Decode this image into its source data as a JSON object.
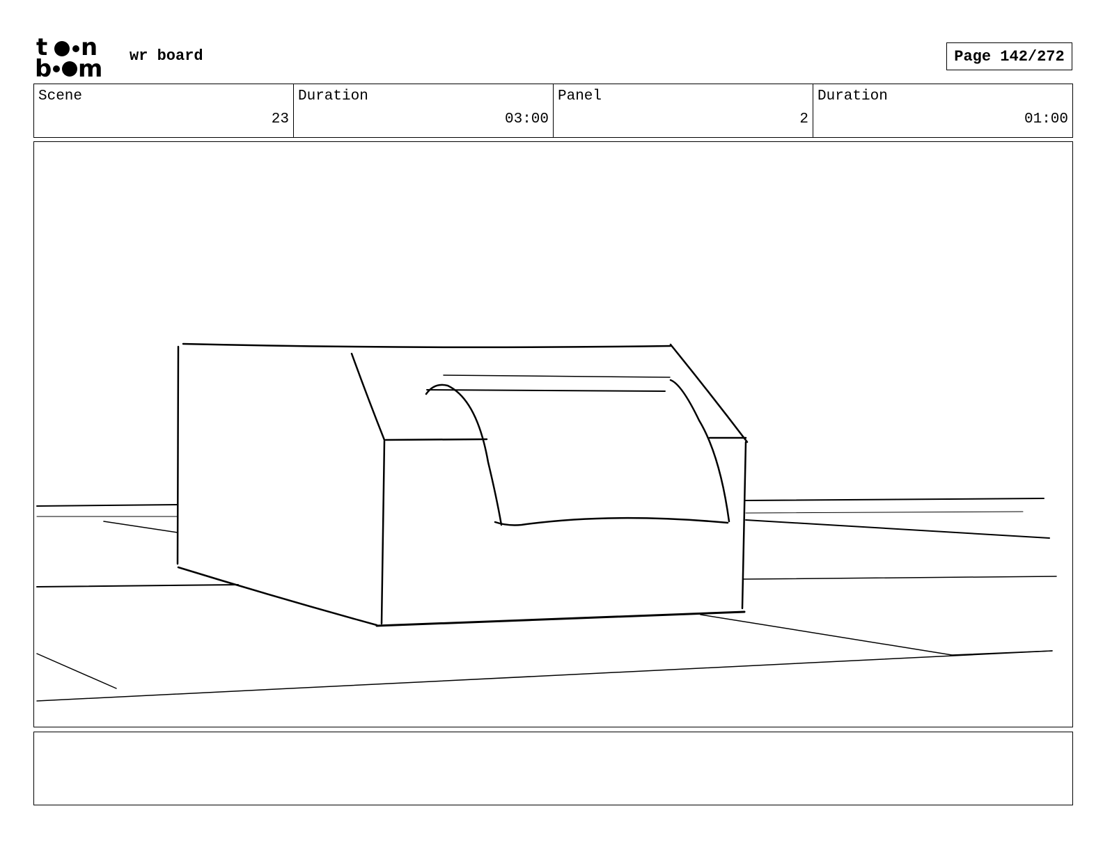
{
  "header": {
    "logo_top": "t••n",
    "logo_bottom": "b••m",
    "board_title": "wr board",
    "page_label": "Page 142/272"
  },
  "info": {
    "scene_label": "Scene",
    "scene_value": "23",
    "scene_duration_label": "Duration",
    "scene_duration_value": "03:00",
    "panel_label": "Panel",
    "panel_value": "2",
    "panel_duration_label": "Duration",
    "panel_duration_value": "01:00"
  },
  "notes": {
    "text": ""
  }
}
